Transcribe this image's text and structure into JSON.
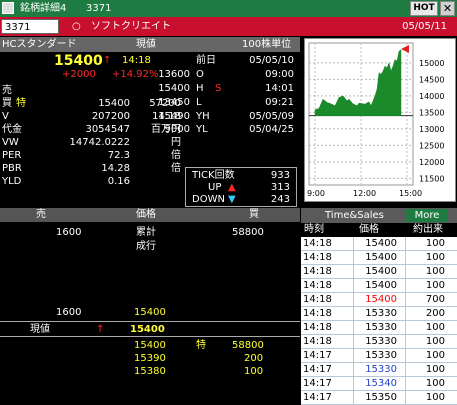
{
  "titlebar": {
    "title": "銘柄詳細4",
    "code": "3371",
    "hot": "HOT",
    "close": "✕"
  },
  "coderow": {
    "code_value": "3371",
    "radio": "○",
    "name": "ソフトクリエイト",
    "date": "05/05/11"
  },
  "header": {
    "label": "HCスタンダード",
    "col_price": "現値",
    "unit": "100株単位"
  },
  "quote": {
    "price": "15400",
    "arrow": "↑",
    "time": "14:18",
    "change": "+2000",
    "change_pct": "+14.92%",
    "fields_left": [
      {
        "label": "売",
        "a": "",
        "b": ""
      },
      {
        "label": "買",
        "flag": "特",
        "a": "15400",
        "b": "57200"
      },
      {
        "label": "V",
        "a": "207200",
        "b": "14:18"
      },
      {
        "label": "代金",
        "a": "3054547",
        "b": "百万円"
      },
      {
        "label": "VW",
        "a": "14742.0222",
        "b": "円"
      },
      {
        "label": "PER",
        "a": "72.3",
        "b": "倍"
      },
      {
        "label": "PBR",
        "a": "14.28",
        "b": "倍"
      },
      {
        "label": "YLD",
        "a": "0.16",
        "b": ""
      }
    ],
    "fields_right": [
      {
        "val": "13400",
        "label": "前日",
        "t": "05/05/10"
      },
      {
        "val": "13600",
        "label": "O",
        "t": "09:00"
      },
      {
        "val": "15400",
        "label": "H",
        "flag": "S",
        "t": "14:01"
      },
      {
        "val": "13450",
        "label": "L",
        "t": "09:21"
      },
      {
        "val": "15490",
        "label": "YH",
        "t": "05/05/09"
      },
      {
        "val": "9000",
        "label": "YL",
        "t": "05/04/25"
      }
    ]
  },
  "chart": {
    "y_ticks": [
      "15000",
      "14500",
      "14000",
      "13500",
      "13000",
      "12500",
      "12000",
      "11500"
    ],
    "x_ticks": [
      "9:00",
      "12:00",
      "15:00"
    ],
    "prev_close": 13400,
    "ylim": [
      11300,
      15600
    ],
    "line_color": "#1a8a2a"
  },
  "tick": {
    "label": "TICK回数",
    "count": "933",
    "up_label": "UP",
    "up": "313",
    "down_label": "DOWN",
    "down": "243"
  },
  "orderbook": {
    "headers": {
      "sell": "売",
      "price": "価格",
      "buy": "買"
    },
    "top": [
      {
        "sell": "1600",
        "label": "累計",
        "buy": "58800"
      },
      {
        "label": "成行"
      }
    ],
    "sell_row": {
      "sell": "1600",
      "price": "15400"
    },
    "current": {
      "label": "現値",
      "arrow": "↑",
      "price": "15400"
    },
    "buys": [
      {
        "price": "15400",
        "flag": "特",
        "buy": "58800"
      },
      {
        "price": "15390",
        "buy": "200"
      },
      {
        "price": "15380",
        "buy": "100"
      }
    ]
  },
  "timesales": {
    "title": "Time&Sales",
    "more": "More",
    "cols": {
      "time": "時刻",
      "price": "価格",
      "vol": "約出来"
    },
    "rows": [
      {
        "time": "14:18",
        "price": "15400",
        "vol": "100",
        "color": "#000"
      },
      {
        "time": "14:18",
        "price": "15400",
        "vol": "100",
        "color": "#000"
      },
      {
        "time": "14:18",
        "price": "15400",
        "vol": "100",
        "color": "#000"
      },
      {
        "time": "14:18",
        "price": "15400",
        "vol": "100",
        "color": "#000"
      },
      {
        "time": "14:18",
        "price": "15400",
        "vol": "700",
        "color": "#ff0000"
      },
      {
        "time": "14:18",
        "price": "15330",
        "vol": "200",
        "color": "#000"
      },
      {
        "time": "14:18",
        "price": "15330",
        "vol": "100",
        "color": "#000"
      },
      {
        "time": "14:18",
        "price": "15330",
        "vol": "100",
        "color": "#000"
      },
      {
        "time": "14:17",
        "price": "15330",
        "vol": "100",
        "color": "#000"
      },
      {
        "time": "14:17",
        "price": "15330",
        "vol": "100",
        "color": "#2244cc"
      },
      {
        "time": "14:17",
        "price": "15340",
        "vol": "100",
        "color": "#2244cc"
      },
      {
        "time": "14:17",
        "price": "15350",
        "vol": "100",
        "color": "#000"
      }
    ]
  }
}
